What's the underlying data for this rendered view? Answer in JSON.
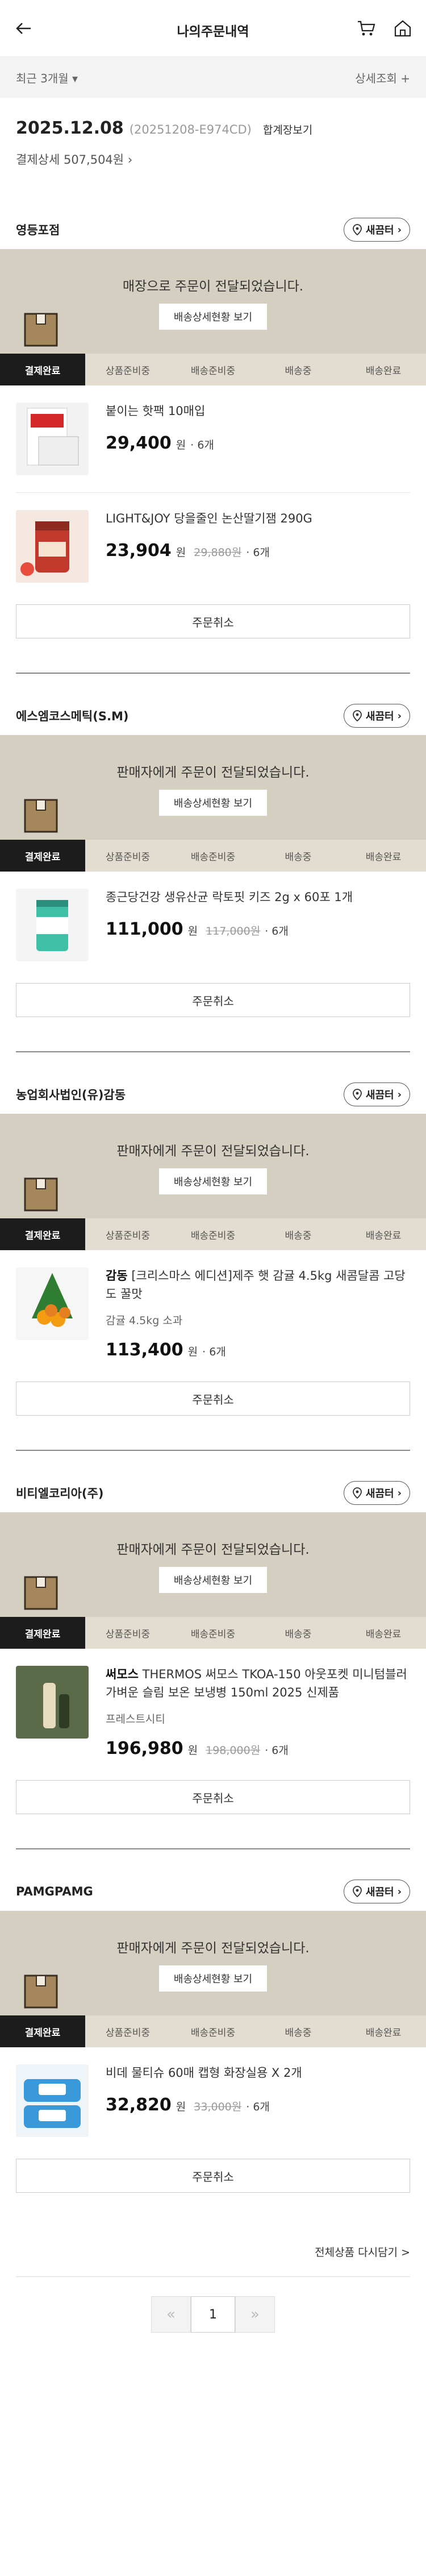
{
  "header": {
    "title": "나의주문내역"
  },
  "filter": {
    "period": "최근 3개월",
    "detail": "상세조회"
  },
  "order": {
    "date": "2025.12.08",
    "number": "(20251208-E974CD)",
    "receipt": "합계장보기",
    "payment": "결제상세 507,504원"
  },
  "common": {
    "shelter_label": "새끔터",
    "detail_btn": "배송상세현황 보기",
    "cancel_label": "주문취소",
    "won": "원",
    "steps": [
      "결제완료",
      "상품준비중",
      "배송준비중",
      "배송중",
      "배송완료"
    ]
  },
  "stores": [
    {
      "name": "영등포점",
      "message": "매장으로 주문이 전달되었습니다.",
      "items": [
        {
          "name": "붙이는 핫팩 10매입",
          "price": "29,400",
          "original": "",
          "qty": "· 6개",
          "seller": ""
        },
        {
          "name": "LIGHT&JOY 당을줄인 논산딸기잼 290G",
          "price": "23,904",
          "original": "29,880원",
          "qty": "· 6개",
          "seller": ""
        }
      ]
    },
    {
      "name": "에스엠코스메틱(S.M)",
      "message": "판매자에게 주문이 전달되었습니다.",
      "items": [
        {
          "name": "종근당건강 생유산균 락토핏 키즈 2g x 60포 1개",
          "price": "111,000",
          "original": "117,000원",
          "qty": "· 6개",
          "seller": ""
        }
      ]
    },
    {
      "name": "농업회사법인(유)감동",
      "message": "판매자에게 주문이 전달되었습니다.",
      "items": [
        {
          "brand": "감동",
          "name": "[크리스마스 에디션]제주 햇 감귤 4.5kg 새콤달콤 고당도 꿀맛",
          "price": "113,400",
          "original": "",
          "qty": "· 6개",
          "seller": "감귤 4.5kg 소과"
        }
      ]
    },
    {
      "name": "비티엘코리아(주)",
      "message": "판매자에게 주문이 전달되었습니다.",
      "items": [
        {
          "brand": "써모스",
          "name": "THERMOS 써모스 TKOA-150 아웃포켓 미니텀블러 가벼운 슬림 보온 보냉병 150ml 2025 신제품",
          "price": "196,980",
          "original": "198,000원",
          "qty": "· 6개",
          "seller": "프레스트시티"
        }
      ]
    },
    {
      "name": "PAMGPAMG",
      "message": "판매자에게 주문이 전달되었습니다.",
      "items": [
        {
          "name": "비데 물티슈 60매 캡형 화장실용 X 2개",
          "price": "32,820",
          "original": "33,000원",
          "qty": "· 6개",
          "seller": ""
        }
      ]
    }
  ],
  "footer": {
    "reorder": "전체상품 다시담기 >",
    "page": "1"
  }
}
